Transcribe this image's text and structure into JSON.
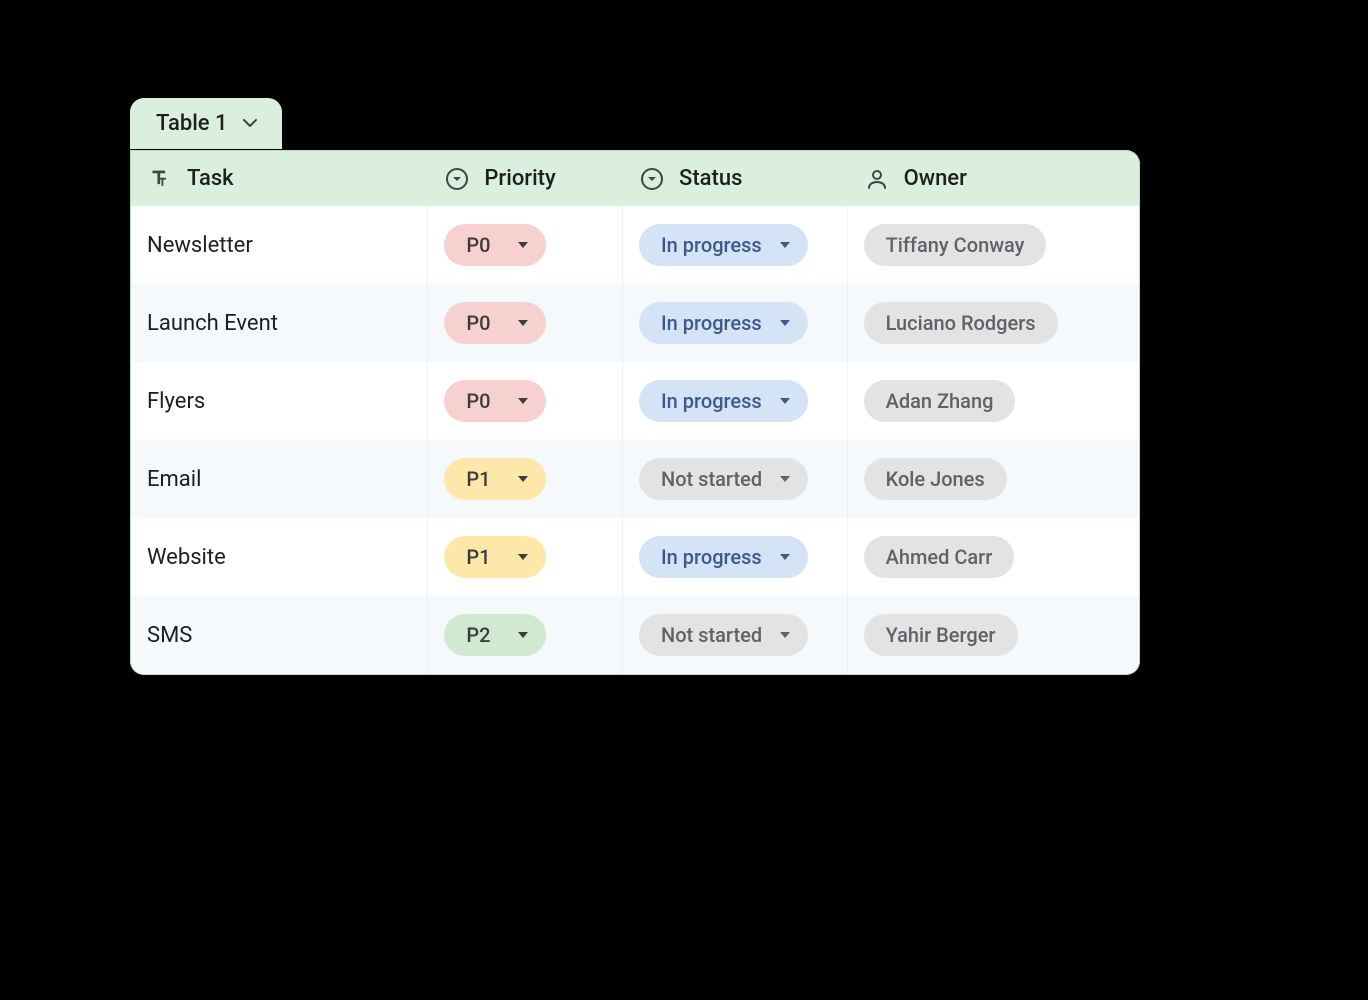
{
  "tab": {
    "label": "Table 1"
  },
  "columns": {
    "task": "Task",
    "priority": "Priority",
    "status": "Status",
    "owner": "Owner"
  },
  "colors": {
    "header_bg": "#daefdd",
    "p0": "#f7d1cf",
    "p1": "#fde8a9",
    "p2": "#d1e8d1",
    "in_progress": "#d4e3f6",
    "not_started": "#e3e3e3",
    "owner_chip": "#e3e3e3"
  },
  "rows": [
    {
      "task": "Newsletter",
      "priority": "P0",
      "status": "In progress",
      "owner": "Tiffany Conway"
    },
    {
      "task": "Launch Event",
      "priority": "P0",
      "status": "In progress",
      "owner": "Luciano Rodgers"
    },
    {
      "task": "Flyers",
      "priority": "P0",
      "status": "In progress",
      "owner": "Adan Zhang"
    },
    {
      "task": "Email",
      "priority": "P1",
      "status": "Not started",
      "owner": "Kole Jones"
    },
    {
      "task": "Website",
      "priority": "P1",
      "status": "In progress",
      "owner": "Ahmed Carr"
    },
    {
      "task": "SMS",
      "priority": "P2",
      "status": "Not started",
      "owner": "Yahir Berger"
    }
  ]
}
